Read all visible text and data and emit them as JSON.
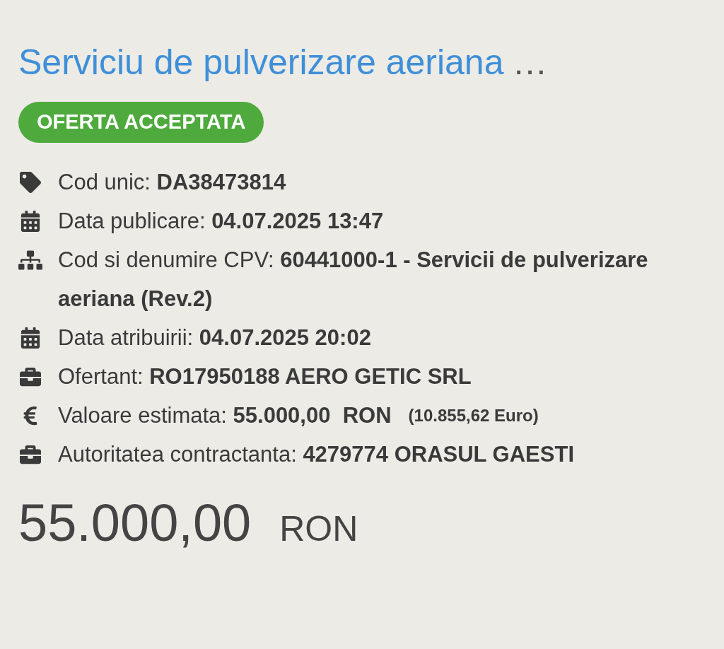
{
  "title": {
    "text": "Serviciu de pulverizare aeriana",
    "ellipsis": "…"
  },
  "status_badge": "OFERTA ACCEPTATA",
  "details": [
    {
      "kind": "tag",
      "text": "Cod unic: **DA38473814**"
    },
    {
      "kind": "calendar",
      "text": "Data publicare: **04.07.2025 13:47**"
    },
    {
      "kind": "sitemap",
      "text": "Cod si denumire CPV: **60441000-1 - Servicii de pulverizare aeriana (Rev.2)**"
    },
    {
      "kind": "calendar",
      "text": "Data atribuirii: **04.07.2025 20:02**"
    },
    {
      "kind": "briefcase",
      "text": "Ofertant: **RO17950188 AERO GETIC SRL**"
    },
    {
      "kind": "euro",
      "text": "Valoare estimata: **55.000,00  RON**",
      "extra": "(10.855,62 Euro)"
    },
    {
      "kind": "briefcase",
      "text": "Autoritatea contractanta: **4279774 ORASUL GAESTI**"
    }
  ],
  "price": {
    "amount": "55.000,00",
    "currency": "RON"
  }
}
